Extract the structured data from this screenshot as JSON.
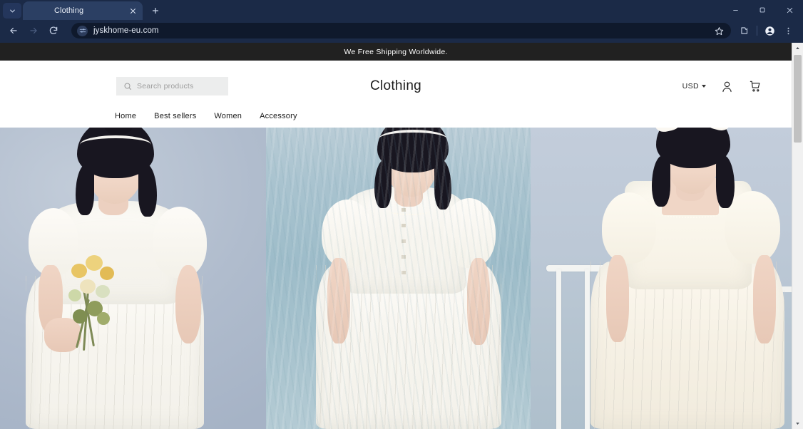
{
  "browser": {
    "tab": {
      "title": "Clothing",
      "close_label": "×"
    },
    "tab_list_icon": "chevron-down-icon",
    "new_tab_label": "+",
    "window_controls": {
      "minimize": "minimize-icon",
      "maximize": "restore-icon",
      "close": "close-icon"
    },
    "toolbar": {
      "back": "back-arrow-icon",
      "forward": "forward-arrow-icon",
      "reload": "reload-icon",
      "site_info_icon": "tune-icon",
      "url": "jyskhome-eu.com",
      "bookmark_icon": "star-icon",
      "extensions_icon": "extensions-icon",
      "profile_icon": "profile-avatar-icon",
      "menu_icon": "three-dot-menu-icon"
    }
  },
  "site": {
    "announcement": "We Free Shipping Worldwide.",
    "search": {
      "placeholder": "Search products",
      "icon": "search-icon"
    },
    "title": "Clothing",
    "currency": {
      "label": "USD",
      "caret": "chevron-down-icon"
    },
    "account_icon": "account-person-icon",
    "cart_icon": "shopping-cart-icon",
    "nav": [
      {
        "label": "Home"
      },
      {
        "label": "Best sellers"
      },
      {
        "label": "Women"
      },
      {
        "label": "Accessory"
      }
    ],
    "hero": {
      "panels": [
        {
          "alt": "Model in white eyelet dress holding yellow flowers"
        },
        {
          "alt": "Model in white button-front dress by the sea"
        },
        {
          "alt": "Model in cream square-neck dress by a white railing"
        }
      ]
    }
  },
  "scrollbar": {
    "up_arrow": "scroll-up-icon",
    "down_arrow": "scroll-down-icon"
  }
}
